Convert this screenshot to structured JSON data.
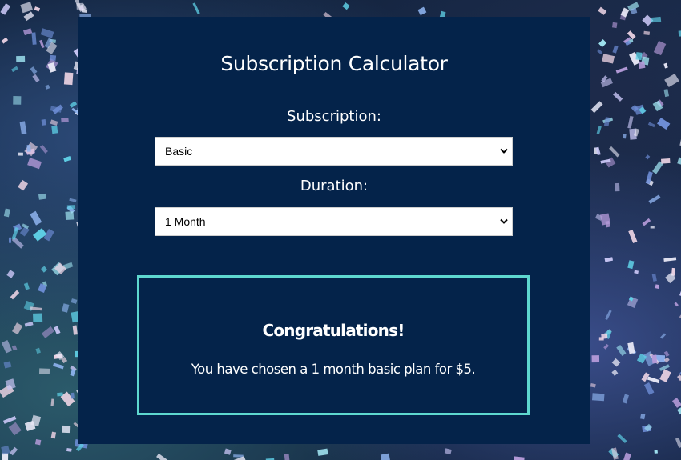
{
  "page": {
    "title": "Subscription Calculator",
    "colors": {
      "card_background": "#04234a",
      "result_border": "#5ed7cf",
      "text": "#ffffff"
    },
    "background_image": "confetti"
  },
  "form": {
    "subscription": {
      "label": "Subscription:",
      "selected": "Basic"
    },
    "duration": {
      "label": "Duration:",
      "selected": "1 Month"
    }
  },
  "result": {
    "heading": "Congratulations!",
    "message": "You have chosen a 1 month basic plan for $5."
  },
  "icons": {
    "select_arrow": "chevron-down-icon"
  }
}
